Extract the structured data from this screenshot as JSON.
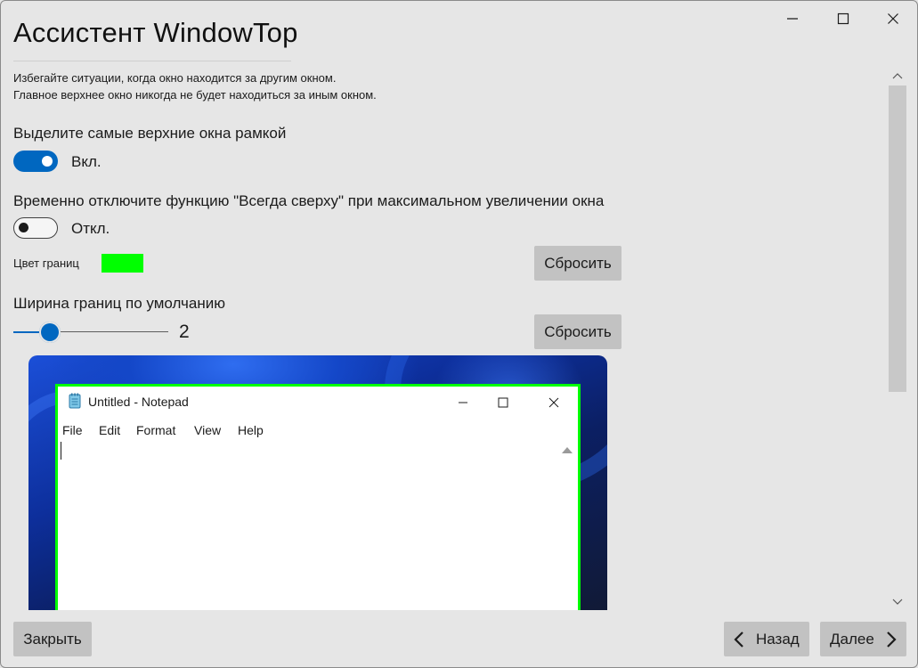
{
  "window": {
    "title": "Ассистент WindowTop"
  },
  "description": {
    "line1": "Избегайте ситуации, когда окно находится за другим окном.",
    "line2": "Главное верхнее окно никогда не будет находиться за иным окном."
  },
  "highlight_topmost": {
    "label": "Выделите самые верхние окна рамкой",
    "state": "Вкл."
  },
  "disable_on_maximize": {
    "label": "Временно отключите функцию \"Всегда сверху\" при максимальном увеличении окна",
    "state": "Откл."
  },
  "border_color": {
    "label": "Цвет границ",
    "color": "#00ff00",
    "reset_label": "Сбросить"
  },
  "border_width": {
    "label": "Ширина границ по умолчанию",
    "value": "2",
    "reset_label": "Сбросить"
  },
  "preview": {
    "notepad_title": "Untitled - Notepad",
    "menu": [
      "File",
      "Edit",
      "Format",
      "View",
      "Help"
    ]
  },
  "footer": {
    "close_label": "Закрыть",
    "back_label": "Назад",
    "next_label": "Далее"
  },
  "colors": {
    "accent": "#0067c0",
    "border_preview": "#00ff00",
    "button_bg": "#c2c2c2"
  }
}
